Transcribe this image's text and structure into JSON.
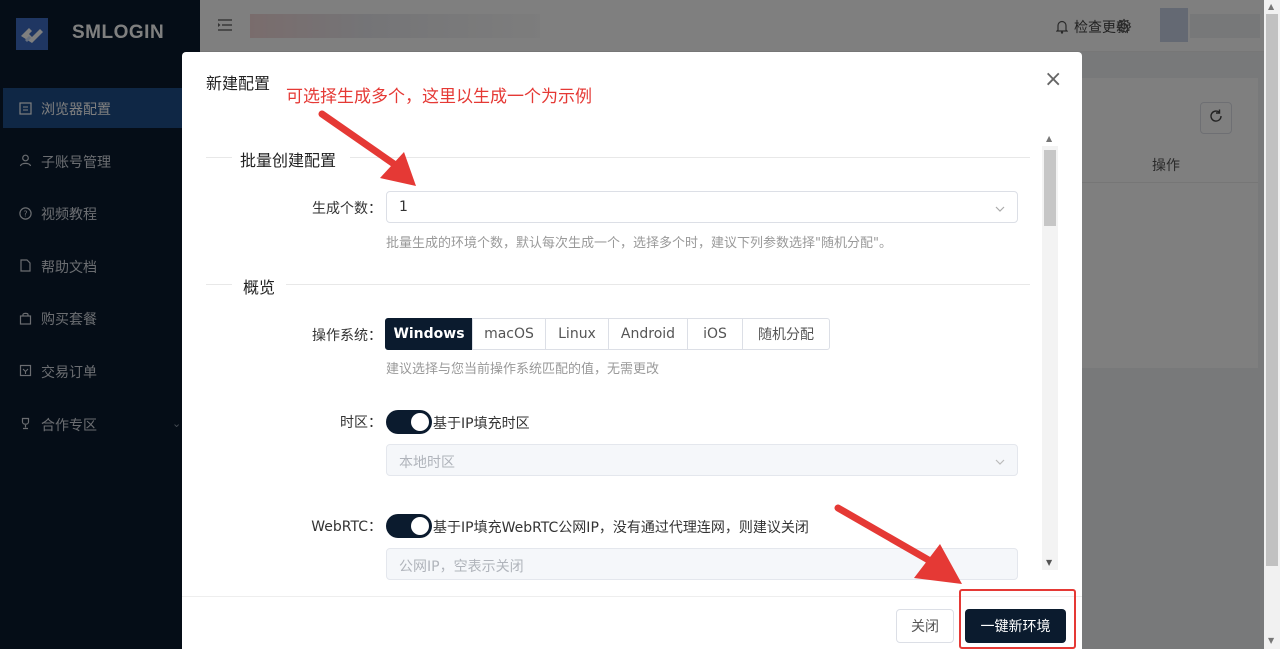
{
  "app": {
    "brand": "SMLOGIN",
    "brand_color": "#0b1b2e",
    "accent": "#1f4f8a"
  },
  "sidebar": {
    "items": [
      {
        "label": "浏览器配置",
        "icon": "profile-icon",
        "active": true
      },
      {
        "label": "子账号管理",
        "icon": "user-icon"
      },
      {
        "label": "视频教程",
        "icon": "help-circle-icon"
      },
      {
        "label": "帮助文档",
        "icon": "document-icon"
      },
      {
        "label": "购买套餐",
        "icon": "shopping-bag-icon"
      },
      {
        "label": "交易订单",
        "icon": "order-icon"
      },
      {
        "label": "合作专区",
        "icon": "trophy-icon",
        "has_submenu": true
      }
    ]
  },
  "topbar": {
    "update_label": "检查更新"
  },
  "page": {
    "table_header_action": "操作"
  },
  "modal": {
    "title": "新建配置",
    "batch_section": "批量创建配置",
    "count_label": "生成个数：",
    "count_value": "1",
    "count_hint": "批量生成的环境个数，默认每次生成一个，选择多个时，建议下列参数选择\"随机分配\"。",
    "overview_section": "概览",
    "os_label": "操作系统：",
    "os_options": [
      "Windows",
      "macOS",
      "Linux",
      "Android",
      "iOS",
      "随机分配"
    ],
    "os_selected": "Windows",
    "os_hint": "建议选择与您当前操作系统匹配的值，无需更改",
    "timezone_label": "时区：",
    "timezone_toggle_text": "基于IP填充时区",
    "timezone_toggle_on": true,
    "timezone_placeholder": "本地时区",
    "webrtc_label": "WebRTC：",
    "webrtc_toggle_text": "基于IP填充WebRTC公网IP，没有通过代理连网，则建议关闭",
    "webrtc_toggle_on": true,
    "webrtc_placeholder": "公网IP，空表示关闭",
    "close_button": "关闭",
    "create_button": "一键新环境"
  },
  "annotations": {
    "note_text": "可选择生成多个，这里以生成一个为示例",
    "color": "#e53935"
  }
}
